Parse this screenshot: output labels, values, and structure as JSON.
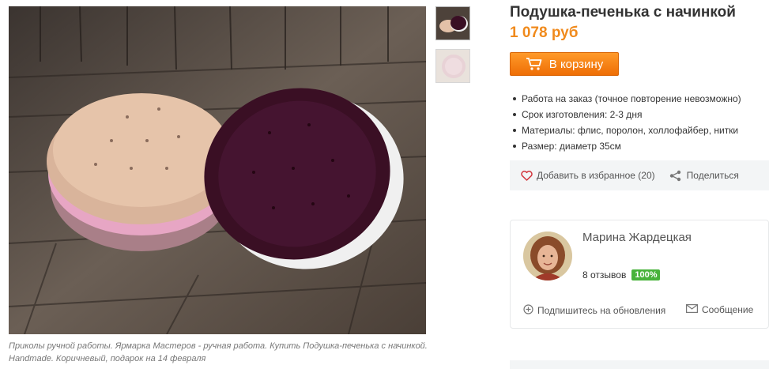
{
  "product": {
    "title": "Подушка-печенька с начинкой",
    "price": "1 078 руб",
    "cart_label": "В корзину",
    "features": [
      "Работа на заказ  (точное повторение невозможно)",
      "Срок изготовления: 2-3 дня",
      "Материалы: флис, поролон, холлофайбер, нитки",
      "Размер: диаметр 35см"
    ]
  },
  "gallery": {
    "caption": "Приколы ручной работы. Ярмарка Мастеров - ручная работа. Купить Подушка-печенька с начинкой. Handmade. Коричневый, подарок на 14 февраля",
    "thumbnails": [
      "thumbnail-chocolate-cookie",
      "thumbnail-light-cookie"
    ]
  },
  "actions": {
    "favorite_label": "Добавить в избранное (20)",
    "share_label": "Поделиться"
  },
  "seller": {
    "name": "Марина Жардецкая",
    "reviews": "8 отзывов",
    "rating": "100%",
    "subscribe_label": "Подпишитесь на обновления",
    "message_label": "Сообщение"
  },
  "colors": {
    "price": "#f08a1c",
    "cart_button": "#f7820f",
    "rating_badge": "#48b33b",
    "cookie_dark": "#3a0f24",
    "cookie_light": "#e3c1a8"
  }
}
